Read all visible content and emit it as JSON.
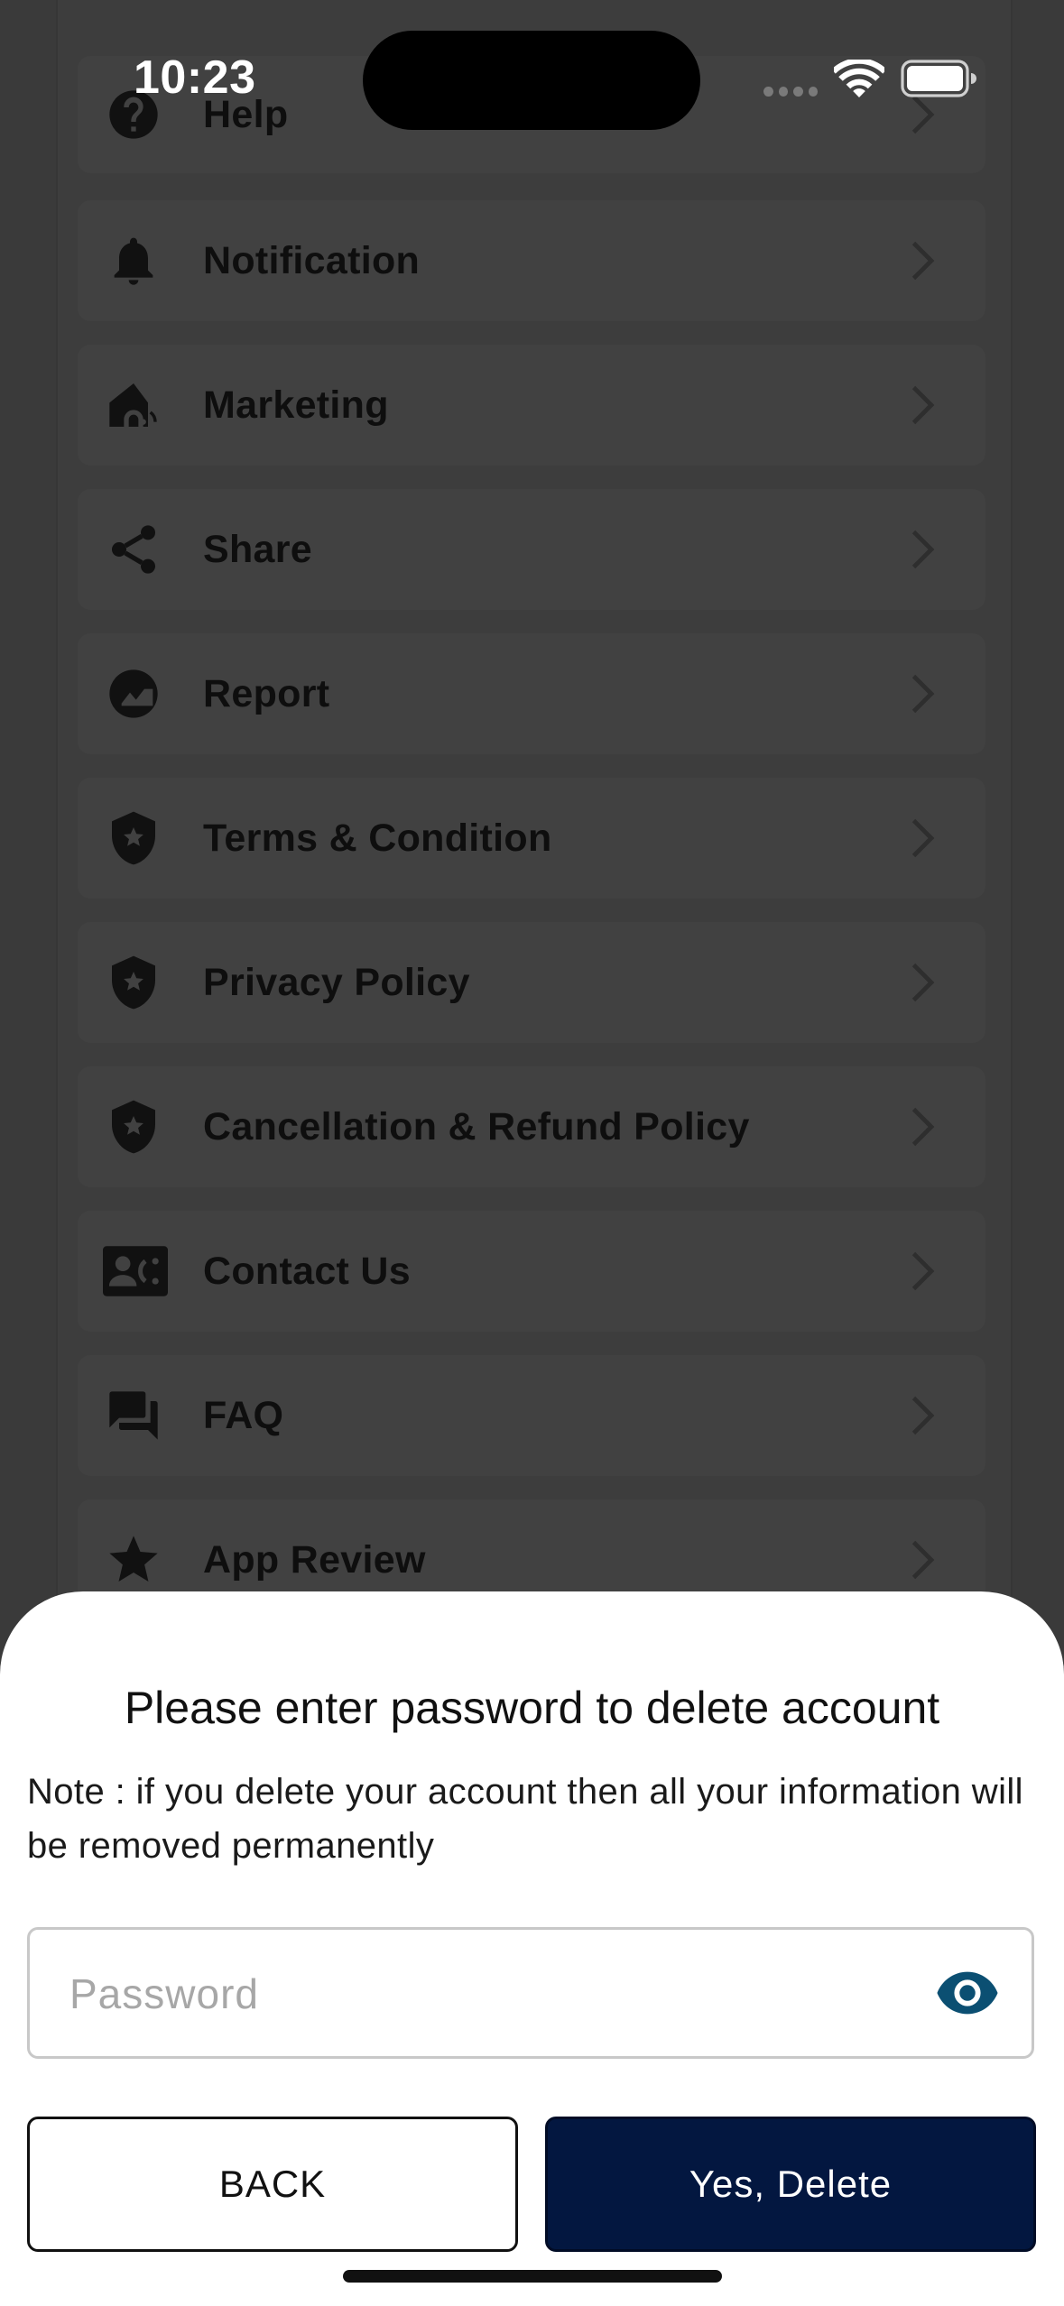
{
  "status_bar": {
    "time": "10:23"
  },
  "menu": {
    "items": [
      {
        "label": "Help",
        "icon": "help-icon"
      },
      {
        "label": "Notification",
        "icon": "bell-icon"
      },
      {
        "label": "Marketing",
        "icon": "marketing-icon"
      },
      {
        "label": "Share",
        "icon": "share-icon"
      },
      {
        "label": "Report",
        "icon": "report-icon"
      },
      {
        "label": "Terms & Condition",
        "icon": "shield-star-icon"
      },
      {
        "label": "Privacy Policy",
        "icon": "shield-star-icon"
      },
      {
        "label": "Cancellation & Refund Policy",
        "icon": "shield-star-icon"
      },
      {
        "label": "Contact Us",
        "icon": "contact-card-icon"
      },
      {
        "label": "FAQ",
        "icon": "chat-bubbles-icon"
      },
      {
        "label": "App Review",
        "icon": "star-icon"
      }
    ]
  },
  "dialog": {
    "title": "Please enter password to delete account",
    "note": "Note : if you delete your account then all your information will be removed permanently",
    "password_placeholder": "Password",
    "password_value": "",
    "back_label": "BACK",
    "delete_label": "Yes, Delete"
  },
  "colors": {
    "overlay_background": "#3a3a3a",
    "primary_button": "#031740",
    "eye_icon": "#0b4f72"
  }
}
